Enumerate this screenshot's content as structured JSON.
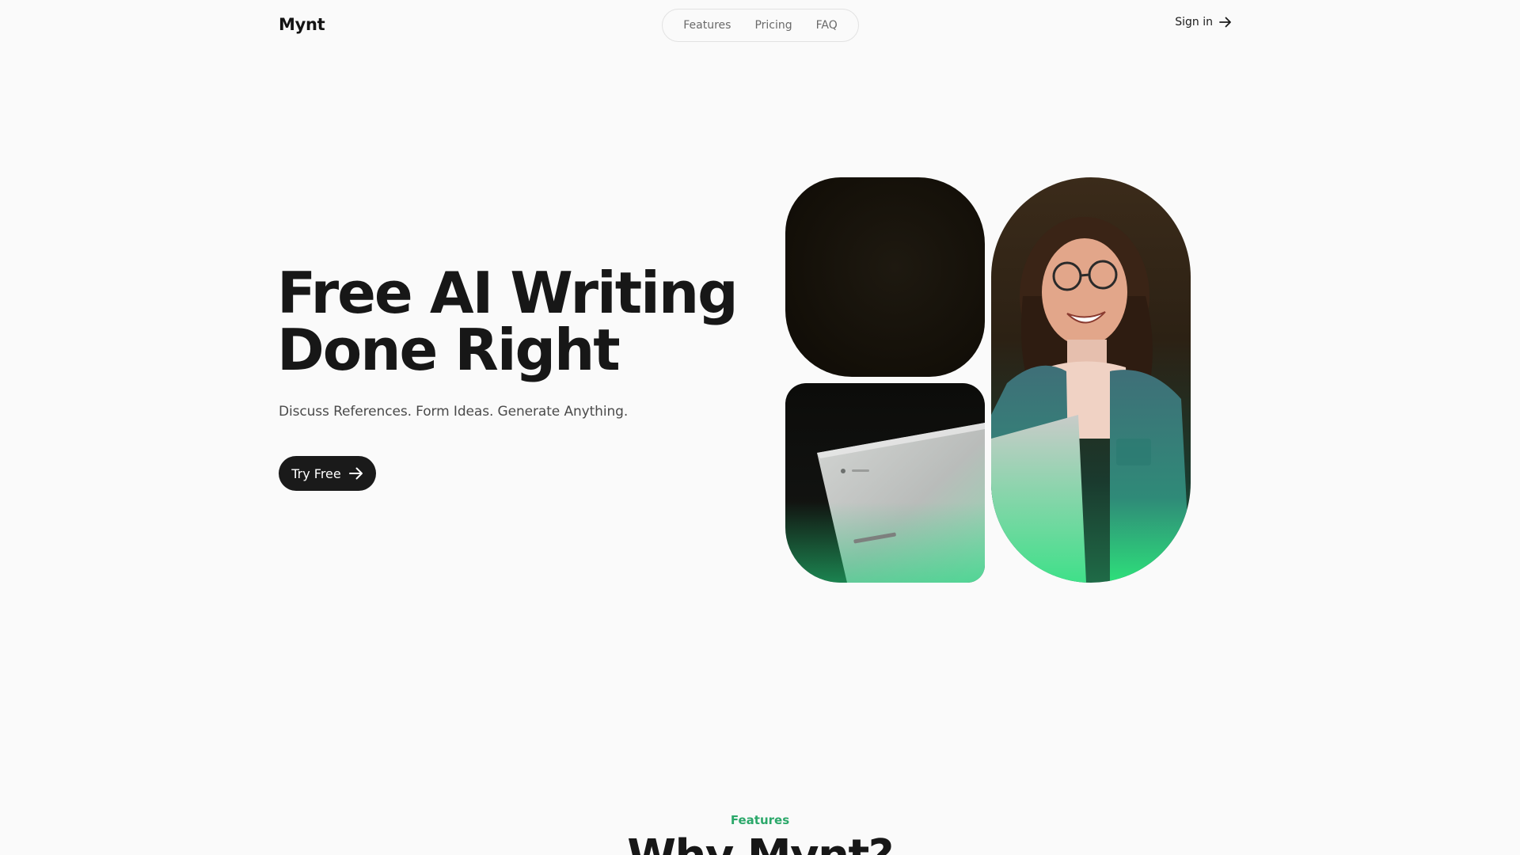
{
  "brand": {
    "name": "Mynt"
  },
  "nav": {
    "links": [
      {
        "label": "Features"
      },
      {
        "label": "Pricing"
      },
      {
        "label": "FAQ"
      }
    ],
    "signin_label": "Sign in"
  },
  "hero": {
    "title_line1": "Free AI Writing",
    "title_line2": "Done Right",
    "subtitle": "Discuss References. Form Ideas. Generate Anything.",
    "cta_label": "Try Free"
  },
  "features_section": {
    "eyebrow": "Features",
    "heading": "Why Mynt?"
  },
  "icons": {
    "signin_arrow": "arrow-right-icon",
    "cta_arrow": "arrow-right-icon"
  },
  "colors": {
    "background": "#fafafa",
    "text": "#1a1a1a",
    "accent_green": "#2ba86a",
    "button_dark": "#1a1a1a"
  }
}
